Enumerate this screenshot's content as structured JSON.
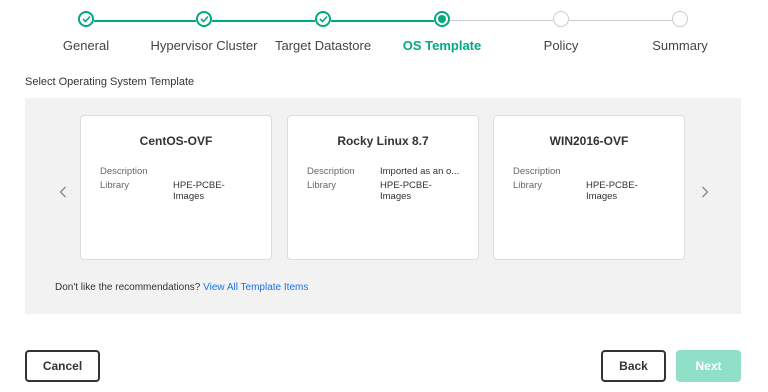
{
  "stepper": {
    "steps": [
      {
        "label": "General",
        "state": "done"
      },
      {
        "label": "Hypervisor Cluster",
        "state": "done"
      },
      {
        "label": "Target Datastore",
        "state": "done"
      },
      {
        "label": "OS Template",
        "state": "active"
      },
      {
        "label": "Policy",
        "state": "todo"
      },
      {
        "label": "Summary",
        "state": "todo"
      }
    ],
    "accent_color": "#01a982",
    "inactive_color": "#cccccc"
  },
  "section_title": "Select Operating System Template",
  "carousel": {
    "prev_icon": "chevron-left-icon",
    "next_icon": "chevron-right-icon",
    "cards": [
      {
        "title": "CentOS-OVF",
        "description_label": "Description",
        "description_value": "",
        "library_label": "Library",
        "library_value": "HPE-PCBE-Images"
      },
      {
        "title": "Rocky Linux 8.7",
        "description_label": "Description",
        "description_value": "Imported as an o...",
        "library_label": "Library",
        "library_value": "HPE-PCBE-Images"
      },
      {
        "title": "WIN2016-OVF",
        "description_label": "Description",
        "description_value": "",
        "library_label": "Library",
        "library_value": "HPE-PCBE-Images"
      }
    ]
  },
  "recommendations": {
    "text": "Don't like the recommendations? ",
    "link": "View All Template Items"
  },
  "footer": {
    "cancel_label": "Cancel",
    "back_label": "Back",
    "next_label": "Next"
  }
}
